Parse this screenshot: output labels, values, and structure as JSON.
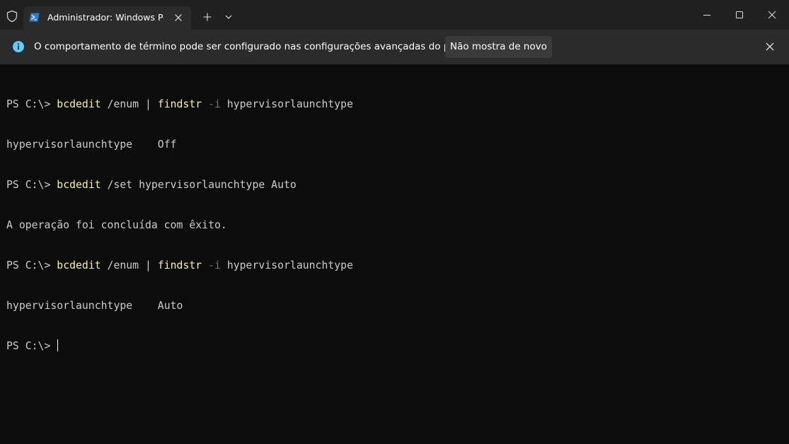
{
  "titlebar": {
    "tab_title": "Administrador: Windows Pow",
    "icons": {
      "admin": "shield-icon",
      "tab": "powershell-icon",
      "tab_close": "close-icon",
      "new_tab": "plus-icon",
      "dropdown": "chevron-down-icon",
      "minimize": "minimize-icon",
      "maximize": "maximize-icon",
      "close": "close-icon"
    }
  },
  "infobar": {
    "message": "O comportamento de término pode ser configurado nas configurações avançadas do perfil.",
    "dismiss_label": "Não mostra de novo",
    "icon": "info-icon",
    "accent": "#60cdff"
  },
  "terminal": {
    "lines": [
      {
        "prompt": "PS C:\\> ",
        "cmd": "bcdedit",
        "a1": " /enum | ",
        "cmd2": "findstr",
        "p": " -i",
        "a2": " hypervisorlaunchtype"
      },
      {
        "text": "hypervisorlaunchtype    Off"
      },
      {
        "prompt": "PS C:\\> ",
        "cmd": "bcdedit",
        "a1": " /set hypervisorlaunchtype Auto"
      },
      {
        "text": "A operação foi concluída com êxito."
      },
      {
        "prompt": "PS C:\\> ",
        "cmd": "bcdedit",
        "a1": " /enum | ",
        "cmd2": "findstr",
        "p": " -i",
        "a2": " hypervisorlaunchtype"
      },
      {
        "text": "hypervisorlaunchtype    Auto"
      },
      {
        "prompt": "PS C:\\> "
      }
    ],
    "colors": {
      "foreground": "#cccccc",
      "command": "#f9f1a5",
      "parameter": "#767676",
      "background": "#0c0c0c"
    }
  }
}
